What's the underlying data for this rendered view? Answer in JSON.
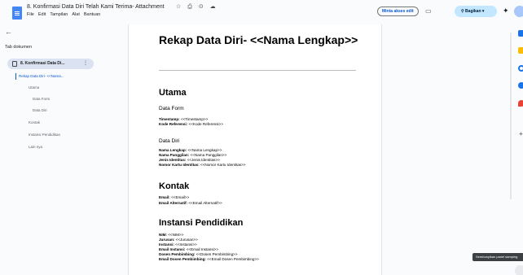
{
  "header": {
    "doc_title": "8. Konfirmasi Data Diri Telah Kami Terima- Attachment",
    "title_icons": "☆ ⎙ ⊙ ☁",
    "menu": [
      "File",
      "Edit",
      "Tampilan",
      "Alat",
      "Bantuan"
    ],
    "access_button": "Minta akses edit",
    "meet_icon": "▭",
    "share_button": "⚲ Bagikan ▾",
    "sparkle_icon": "✦"
  },
  "sidebar": {
    "back_icon": "←",
    "heading": "Tab dokumen",
    "tab": {
      "label": "8. Konfirmasi Data Di...",
      "more": "⋮"
    },
    "outline": [
      "Rekap Data Diri- <<Nama...",
      "Utama",
      "Data Form",
      "Data Diri",
      "Kontak",
      "Instansi Pendidikan",
      "Lain nya"
    ]
  },
  "document": {
    "title": "Rekap Data Diri- <<Nama Lengkap>>",
    "sections": {
      "utama": "Utama",
      "data_form": "Data Form",
      "timestamp_label": "Timestamp:",
      "timestamp_value": " <<Timestamp>>",
      "kode_label": "Kode Referensi:",
      "kode_value": " <<Kode Referensi>>",
      "data_diri": "Data Diri",
      "nama_label": "Nama Lengkap:",
      "nama_value": " <<Nama Lengkap>>",
      "panggilan_label": "Nama Panggilan:",
      "panggilan_value": " <<Nama Panggilan>>",
      "jenis_label": "Jenis Identitas:",
      "jenis_value": " <<Jenis Identitas>>",
      "nomor_label": "Nomor Kartu Identitas:",
      "nomor_value": " <<Nomor Kartu Identitas>>",
      "kontak": "Kontak",
      "email_label": "Email:",
      "email_value": " <<Email>>",
      "email_alt_label": "Email Alternatif:",
      "email_alt_value": " <<Email Alternatif>>",
      "instansi_heading": "Instansi Pendidikan",
      "nim_label": "NIM:",
      "nim_value": " <<NIM>>",
      "jurusan_label": "Jurusan:",
      "jurusan_value": " <<Jurusan>>",
      "instansi_label": "Instansi:",
      "instansi_value": " <<Instansi>>",
      "email_instansi_label": "Email Instansi:",
      "email_instansi_value": " <<Email Instansi>>",
      "dosen_label": "Dosen Pembimbing:",
      "dosen_value": " <<Dosen Pembimbing>>",
      "email_dosen_label": "Email Dosen Pembimbing:",
      "email_dosen_value": " <<Email Dosen Pembimbing>>"
    }
  },
  "right_rail": {
    "plus_icon": "+",
    "tooltip": "Sembunyikan panel samping"
  },
  "colors": {
    "accent": "#0b57d0",
    "share_bg": "#c2e7ff",
    "tab_selected_bg": "#dbe2f2",
    "doc_icon": "#4285f4"
  }
}
